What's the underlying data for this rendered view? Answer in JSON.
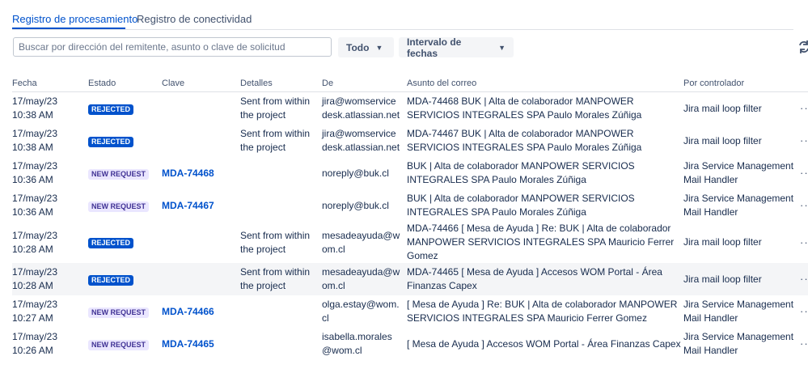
{
  "tabs": [
    {
      "label": "Registro de procesamiento",
      "active": true
    },
    {
      "label": "Registro de conectividad",
      "active": false
    }
  ],
  "search": {
    "placeholder": "Buscar por dirección del remitente, asunto o clave de solicitud",
    "value": ""
  },
  "filters": {
    "status_label": "Todo",
    "date_label": "Intervalo de fechas"
  },
  "icons": {
    "refresh": "refresh-icon",
    "chevron": "chevron-down-icon",
    "more": "more-icon"
  },
  "colors": {
    "accent": "#0052cc",
    "rejected_bg": "#0052cc",
    "new_request_bg": "#eae6ff",
    "new_request_text": "#403294"
  },
  "table": {
    "headers": [
      "Fecha",
      "Estado",
      "Clave",
      "Detalles",
      "De",
      "Asunto del correo",
      "Por controlador"
    ],
    "rows": [
      {
        "date": "17/may/23",
        "time": "10:38 AM",
        "status": "REJECTED",
        "key": "",
        "details": "Sent from within the project",
        "from": "jira@womservice desk.atlassian.net",
        "subject": "MDA-74468 BUK | Alta de colaborador MANPOWER SERVICIOS INTEGRALES SPA Paulo Morales Zúñiga",
        "handler": "Jira mail loop filter"
      },
      {
        "date": "17/may/23",
        "time": "10:38 AM",
        "status": "REJECTED",
        "key": "",
        "details": "Sent from within the project",
        "from": "jira@womservice desk.atlassian.net",
        "subject": "MDA-74467 BUK | Alta de colaborador MANPOWER SERVICIOS INTEGRALES SPA Paulo Morales Zúñiga",
        "handler": "Jira mail loop filter"
      },
      {
        "date": "17/may/23",
        "time": "10:36 AM",
        "status": "NEW REQUEST",
        "key": "MDA-74468",
        "details": "",
        "from": "noreply@buk.cl",
        "subject": "BUK | Alta de colaborador MANPOWER SERVICIOS INTEGRALES SPA Paulo Morales Zúñiga",
        "handler": "Jira Service Management Mail Handler"
      },
      {
        "date": "17/may/23",
        "time": "10:36 AM",
        "status": "NEW REQUEST",
        "key": "MDA-74467",
        "details": "",
        "from": "noreply@buk.cl",
        "subject": "BUK | Alta de colaborador MANPOWER SERVICIOS INTEGRALES SPA Paulo Morales Zúñiga",
        "handler": "Jira Service Management Mail Handler"
      },
      {
        "date": "17/may/23",
        "time": "10:28 AM",
        "status": "REJECTED",
        "key": "",
        "details": "Sent from within the project",
        "from": "mesadeayuda@w om.cl",
        "subject": "MDA-74466 [ Mesa de Ayuda ] Re: BUK | Alta de colaborador MANPOWER SERVICIOS INTEGRALES SPA Mauricio Ferrer Gomez",
        "handler": "Jira mail loop filter"
      },
      {
        "date": "17/may/23",
        "time": "10:28 AM",
        "status": "REJECTED",
        "key": "",
        "details": "Sent from within the project",
        "from": "mesadeayuda@w om.cl",
        "subject": "MDA-74465 [ Mesa de Ayuda ] Accesos WOM Portal - Área Finanzas Capex",
        "handler": "Jira mail loop filter"
      },
      {
        "date": "17/may/23",
        "time": "10:27 AM",
        "status": "NEW REQUEST",
        "key": "MDA-74466",
        "details": "",
        "from": "olga.estay@wom. cl",
        "subject": "[ Mesa de Ayuda ] Re: BUK | Alta de colaborador MANPOWER SERVICIOS INTEGRALES SPA Mauricio Ferrer Gomez",
        "handler": "Jira Service Management Mail Handler"
      },
      {
        "date": "17/may/23",
        "time": "10:26 AM",
        "status": "NEW REQUEST",
        "key": "MDA-74465",
        "details": "",
        "from": "isabella.morales @wom.cl",
        "subject": "[ Mesa de Ayuda ] Accesos WOM Portal - Área Finanzas Capex",
        "handler": "Jira Service Management Mail Handler"
      }
    ]
  }
}
